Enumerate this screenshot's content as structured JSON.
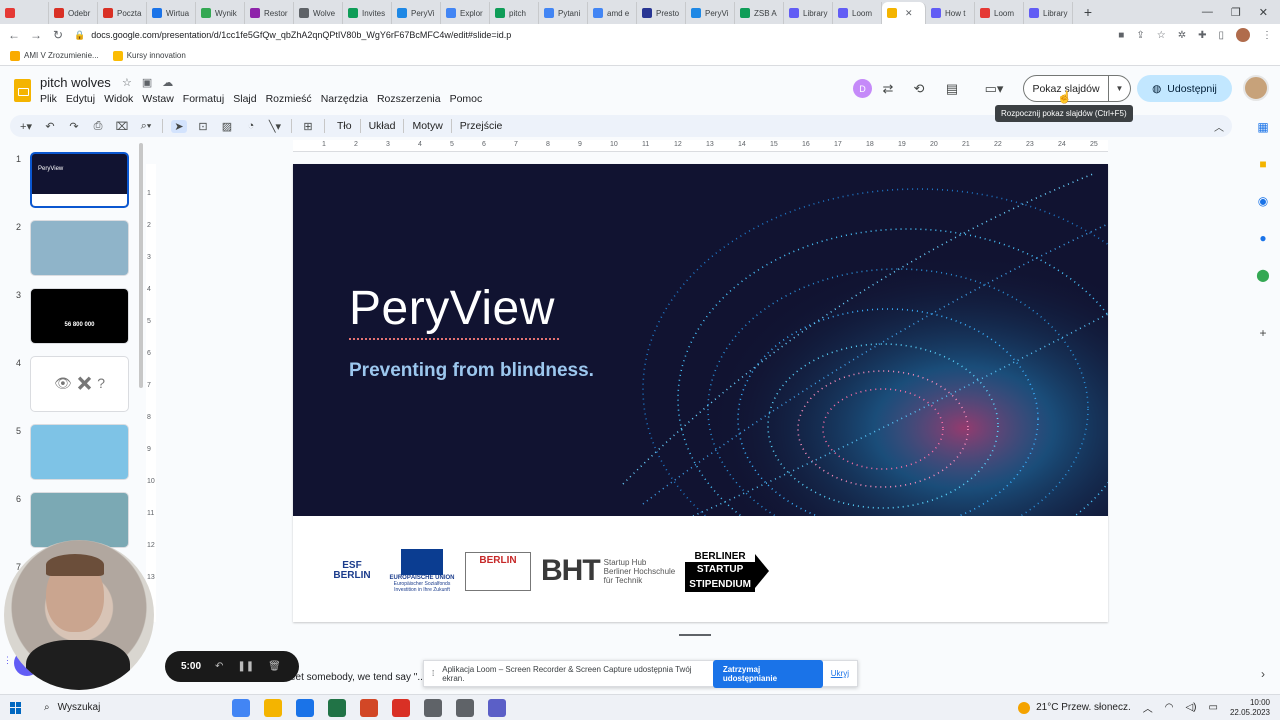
{
  "browser": {
    "tabs": [
      {
        "label": "",
        "color": "#e53935"
      },
      {
        "label": "Odebr",
        "color": "#d93025"
      },
      {
        "label": "Poczta",
        "color": "#d93025"
      },
      {
        "label": "Wirtua",
        "color": "#1a73e8"
      },
      {
        "label": "Wynik",
        "color": "#34a853"
      },
      {
        "label": "Restor",
        "color": "#8e24aa"
      },
      {
        "label": "Wolve",
        "color": "#5f6368"
      },
      {
        "label": "Invites",
        "color": "#0f9d58"
      },
      {
        "label": "PeryVi",
        "color": "#1e88e5"
      },
      {
        "label": "Explor",
        "color": "#4285f4"
      },
      {
        "label": "pitch",
        "color": "#0f9d58"
      },
      {
        "label": "Pytani",
        "color": "#4285f4"
      },
      {
        "label": "amd e",
        "color": "#4285f4"
      },
      {
        "label": "Presto",
        "color": "#283593"
      },
      {
        "label": "PeryVi",
        "color": "#1e88e5"
      },
      {
        "label": "ZSB A",
        "color": "#0f9d58"
      },
      {
        "label": "Library",
        "color": "#625df5"
      },
      {
        "label": "Loom",
        "color": "#625df5"
      },
      {
        "label": "",
        "color": "#f4b400",
        "active": true
      },
      {
        "label": "How t",
        "color": "#625df5"
      },
      {
        "label": "Loom",
        "color": "#e53935"
      },
      {
        "label": "Library",
        "color": "#625df5"
      }
    ],
    "new_tab": "+",
    "url": "docs.google.com/presentation/d/1cc1fe5GfQw_qbZhA2qnQPtIV80b_WgY6rF67BcMFC4w/edit#slide=id.p",
    "bookmarks": [
      {
        "label": "AMI V Zrozumienie...",
        "color": "#f9ab00"
      },
      {
        "label": "Kursy innovation",
        "color": "#fbbc04"
      }
    ]
  },
  "app": {
    "title": "pitch wolves",
    "menu": [
      "Plik",
      "Edytuj",
      "Widok",
      "Wstaw",
      "Formatuj",
      "Slajd",
      "Rozmieść",
      "Narzędzia",
      "Rozszerzenia",
      "Pomoc"
    ],
    "collaborator_initial": "D",
    "slideshow_label": "Pokaz slajdów",
    "share_label": "Udostępnij",
    "tooltip": "Rozpocznij pokaz slajdów (Ctrl+F5)",
    "toolbar_text": [
      "Tło",
      "Układ",
      "Motyw",
      "Przejście"
    ]
  },
  "filmstrip": {
    "slides": [
      {
        "num": "1",
        "bg": "#111331"
      },
      {
        "num": "2",
        "bg": "#8fb4c9"
      },
      {
        "num": "3",
        "bg": "#000000"
      },
      {
        "num": "4",
        "bg": "#ffffff"
      },
      {
        "num": "5",
        "bg": "#7ec3e6"
      },
      {
        "num": "6",
        "bg": "#7ba9b4"
      },
      {
        "num": "7",
        "bg": "#f9fbfd"
      }
    ],
    "thumb3_value": "56 800 000",
    "thumb4_icons": "👁 ✖ ?",
    "thumb1_title": "PeryView"
  },
  "ruler": {
    "top_labels": [
      "1",
      "2",
      "3",
      "4",
      "5",
      "6",
      "7",
      "8",
      "9",
      "10",
      "11",
      "12",
      "13",
      "14",
      "15",
      "16",
      "17",
      "18",
      "19",
      "20",
      "21",
      "22",
      "23",
      "24",
      "25"
    ],
    "left_labels": [
      "1",
      "2",
      "3",
      "4",
      "5",
      "6",
      "7",
      "8",
      "9",
      "10",
      "11",
      "12",
      "13"
    ]
  },
  "slide": {
    "title": "PeryView",
    "subtitle": "Preventing from blindness.",
    "logos": {
      "esf": "ESF BERLIN",
      "eu_line1": "EUROPÄISCHE UNION",
      "eu_line2": "Europäischer Sozialfonds",
      "eu_line3": "Investition in Ihre Zukunft",
      "berlin": "BERLIN",
      "bht": "BHT",
      "bht_sub1": "Startup Hub",
      "bht_sub2": "Berliner Hochschule",
      "bht_sub3": "für Technik",
      "bss1": "BERLINER",
      "bss2": "STARTUP",
      "bss3": "STIPENDIUM"
    }
  },
  "notes": {
    "text": "eet somebody, we tend say \"..."
  },
  "loom": {
    "timer": "5:00",
    "share_message": "Aplikacja Loom – Screen Recorder & Screen Capture udostępnia Twój ekran.",
    "stop_label": "Zatrzymaj udostępnianie",
    "hide_label": "Ukryj"
  },
  "taskbar": {
    "search_label": "Wyszukaj",
    "weather": "21°C  Przew. słonecz.",
    "time": "10:00",
    "date": "22.05.2023",
    "apps": [
      "#4285f4",
      "#f4b400",
      "#1a73e8",
      "#217346",
      "#d24726",
      "#d93025",
      "#5f6368",
      "#5f6368",
      "#5b5fc7"
    ]
  },
  "colors": {
    "accent": "#0b57d0",
    "share_bg": "#c2e7ff",
    "slide_bg": "#111331",
    "subtitle": "#9cc7ee"
  }
}
